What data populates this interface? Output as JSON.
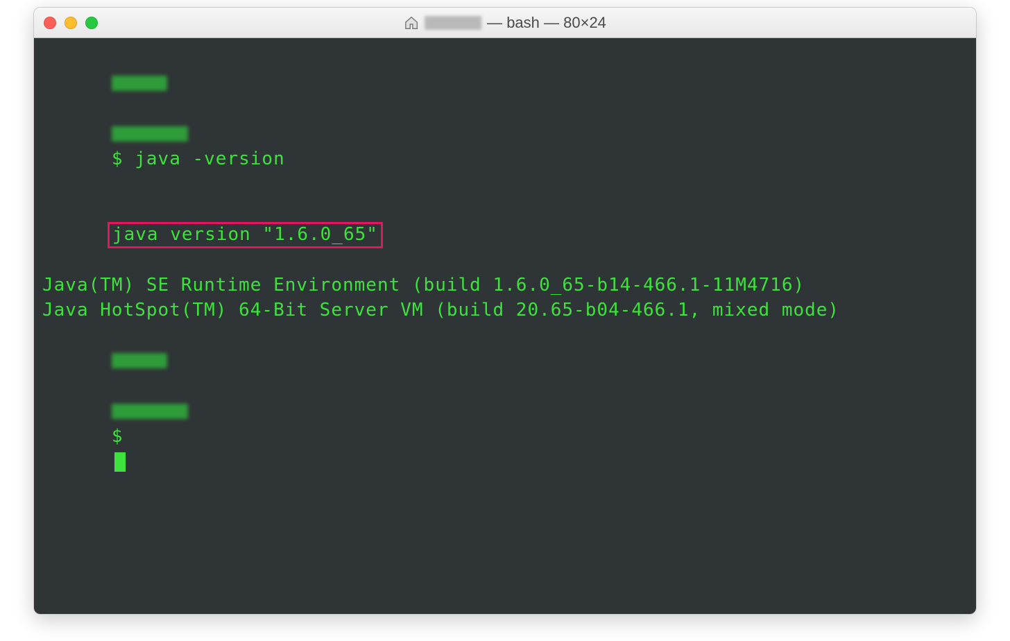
{
  "window": {
    "title_suffix": " — bash — 80×24"
  },
  "terminal": {
    "prompt_symbol": "$",
    "command": "java -version",
    "output_line1": "java version \"1.6.0_65\"",
    "output_line2": "Java(TM) SE Runtime Environment (build 1.6.0_65-b14-466.1-11M4716)",
    "output_line3": "Java HotSpot(TM) 64-Bit Server VM (build 20.65-b04-466.1, mixed mode)"
  }
}
